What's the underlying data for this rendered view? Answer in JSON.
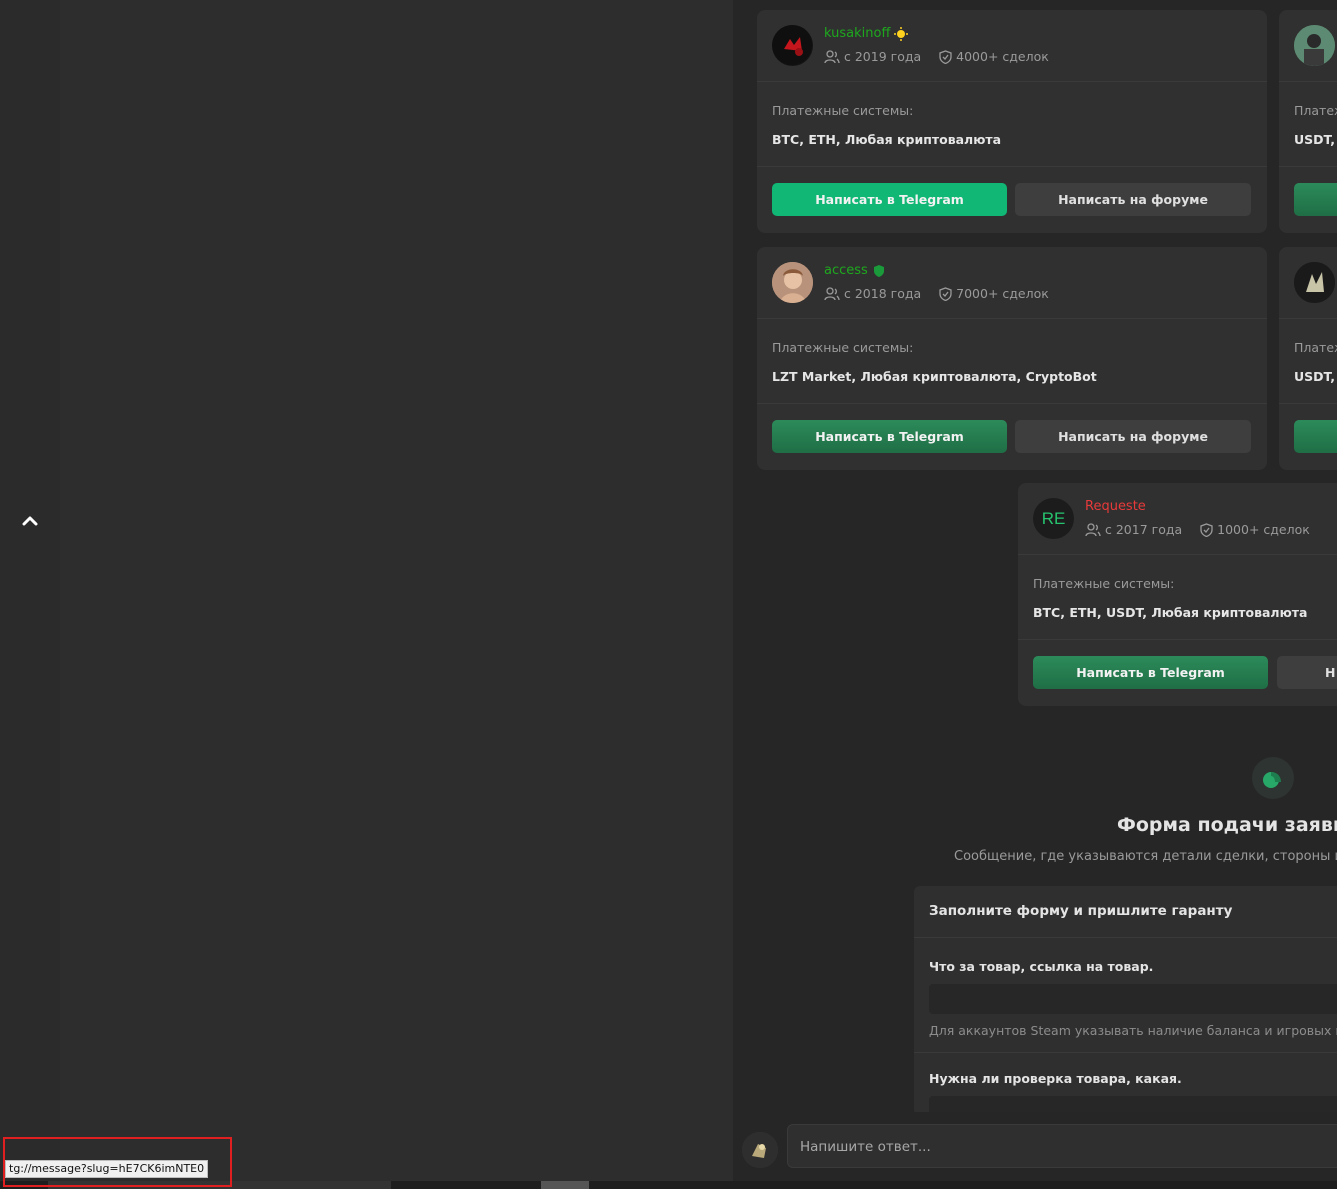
{
  "cards": [
    {
      "username": "kusakinoff",
      "username_color": "#1ea81e",
      "badge": "sun-badge-icon",
      "since": "с 2019 года",
      "deals": "4000+ сделок",
      "pay_label": "Платежные системы:",
      "pay_value": "BTC, ETH, Любая криптовалюта",
      "tg_button": "Написать в Telegram",
      "forum_button": "Написать на форуме"
    },
    {
      "username": "access",
      "username_color": "#1ea81e",
      "badge": "green-shield-badge-icon",
      "since": "с 2018 года",
      "deals": "7000+ сделок",
      "pay_label": "Платежные системы:",
      "pay_value": "LZT Market, Любая криптовалюта, CryptoBot",
      "tg_button": "Написать в Telegram",
      "forum_button": "Написать на форуме"
    },
    {
      "username": "Requeste",
      "username_color": "#e83a3a",
      "avatar_text": "RE",
      "since": "с 2017 года",
      "deals": "1000+ сделок",
      "pay_label": "Платежные системы:",
      "pay_value": "BTC, ETH, USDT, Любая криптовалюта",
      "tg_button": "Написать в Telegram",
      "forum_button": "Н"
    }
  ],
  "partial_cards": [
    {
      "pay_label": "Платеж",
      "pay_value": "USDT, ..."
    },
    {
      "pay_label": "Платеж",
      "pay_value": "USDT, ..."
    }
  ],
  "form": {
    "title": "Форма подачи заявки",
    "subtitle": "Сообщение, где указываются детали сделки, стороны и усло",
    "box_title": "Заполните форму и пришлите гаранту",
    "q1": "Что за товар, ссылка на товар.",
    "hint1": "Для аккаунтов Steam указывать наличие баланса и игровых вещ",
    "q2": "Нужна ли проверка товара, какая."
  },
  "reply": {
    "placeholder": "Напишите ответ..."
  },
  "status_url": "tg://message?slug=hE7CK6imNTE0",
  "colors": {
    "accent_green": "#10b775",
    "button_green": "#2c8b5a"
  }
}
